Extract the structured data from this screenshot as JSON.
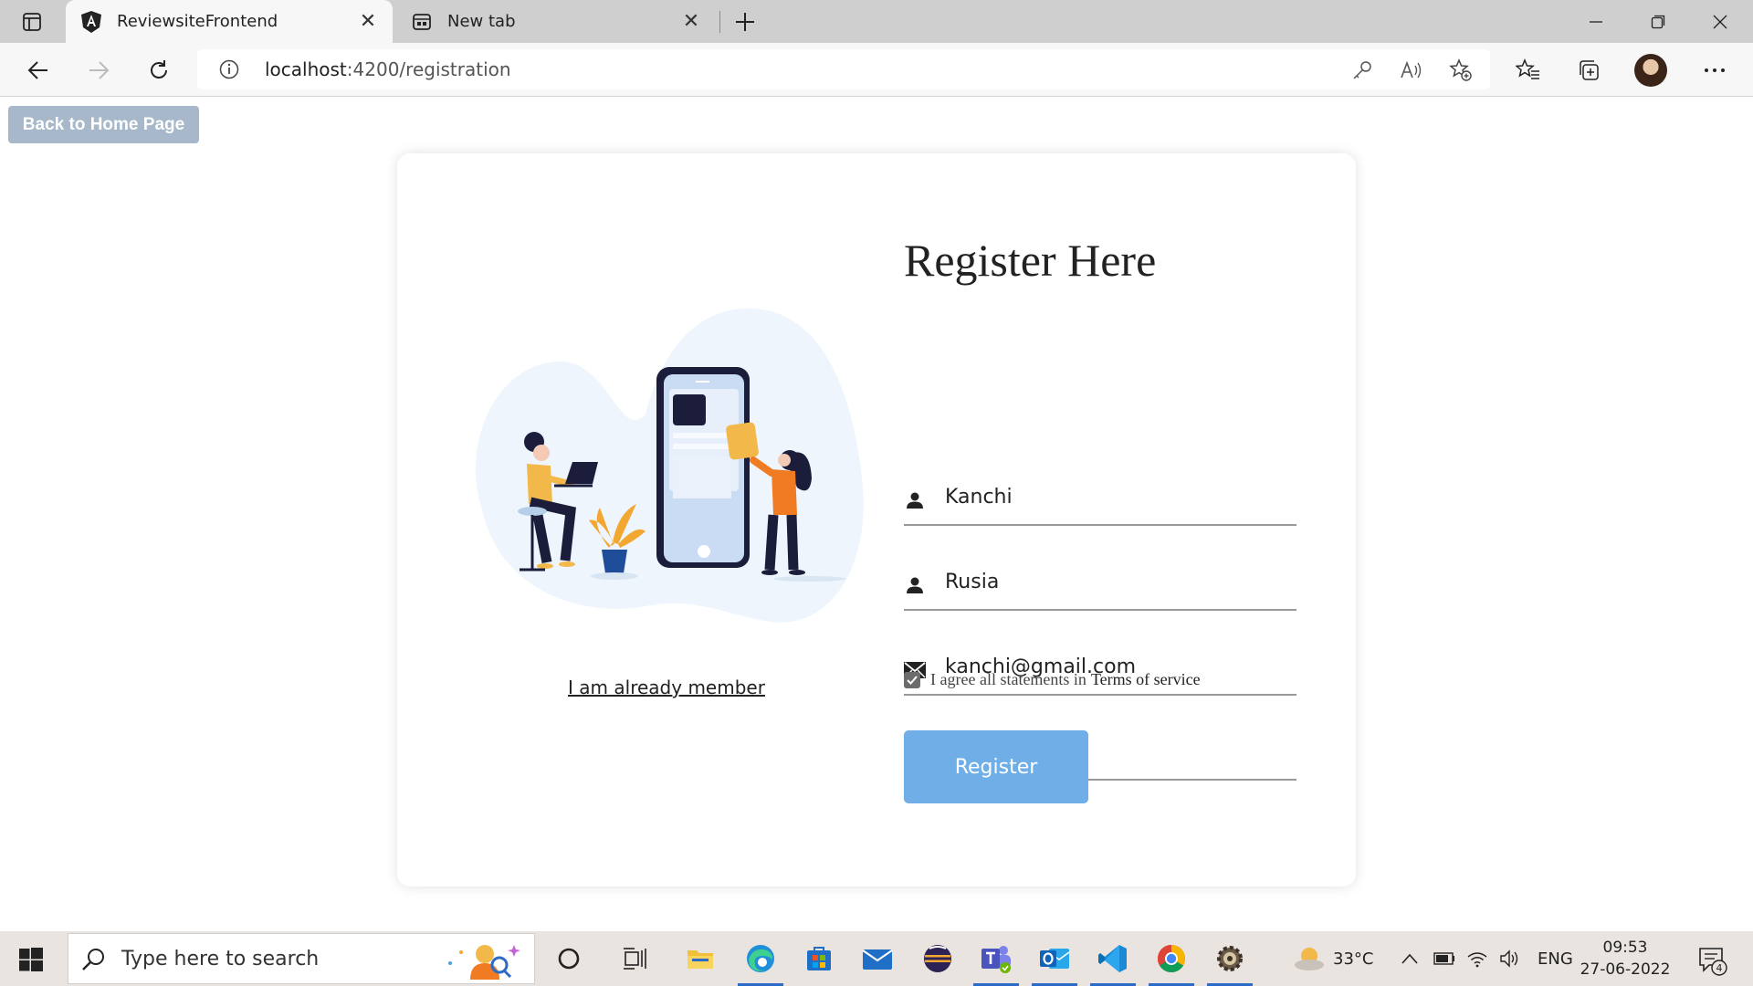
{
  "browser": {
    "tabs": [
      {
        "title": "ReviewsiteFrontend",
        "active": true
      },
      {
        "title": "New tab",
        "active": false
      }
    ],
    "url_host": "localhost",
    "url_path": ":4200/registration"
  },
  "page": {
    "back_button": "Back to Home Page",
    "form_title": "Register Here",
    "fields": {
      "first_name": "Kanchi",
      "last_name": "Rusia",
      "email": "kanchi@gmail.com",
      "password_mask": "•••"
    },
    "agree_text": "I agree all statements in",
    "terms_link": "Terms of service",
    "agree_checked": true,
    "register_button": "Register",
    "member_link": "I am already member"
  },
  "taskbar": {
    "search_placeholder": "Type here to search",
    "weather": "33°C",
    "language": "ENG",
    "time": "09:53",
    "date": "27-06-2022",
    "notification_count": "4"
  },
  "colors": {
    "register_button": "#6faee6",
    "back_button": "#a6b8c9",
    "taskbar_accent": "#2c6ac7"
  }
}
